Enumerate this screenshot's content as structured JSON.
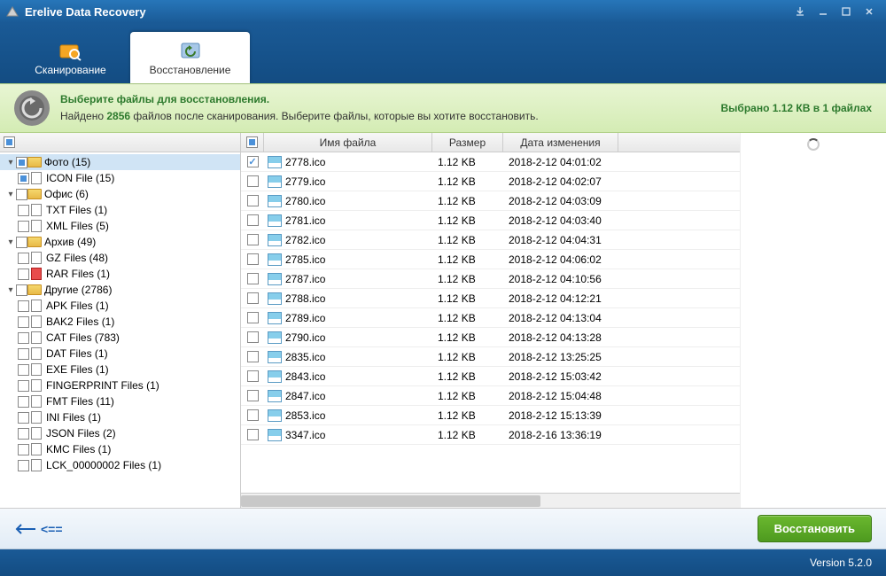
{
  "app": {
    "title": "Erelive Data Recovery"
  },
  "tabs": {
    "scan": "Сканирование",
    "recover": "Восстановление"
  },
  "info": {
    "title": "Выберите файлы для восстановления.",
    "found_prefix": "Найдено ",
    "found_count": "2856",
    "found_suffix": " файлов после сканирования. Выберите файлы, которые вы хотите восстановить.",
    "selected": "Выбрано 1.12 КВ в 1 файлах"
  },
  "tree": {
    "photo": {
      "label": "Фото (15)",
      "children": {
        "icon": "ICON File (15)"
      }
    },
    "office": {
      "label": "Офис (6)",
      "children": {
        "txt": "TXT Files (1)",
        "xml": "XML Files (5)"
      }
    },
    "archive": {
      "label": "Архив (49)",
      "children": {
        "gz": "GZ Files (48)",
        "rar": "RAR Files (1)"
      }
    },
    "other": {
      "label": "Другие (2786)",
      "children": {
        "apk": "APK Files (1)",
        "bak2": "BAK2 Files (1)",
        "cat": "CAT Files (783)",
        "dat": "DAT Files (1)",
        "exe": "EXE Files (1)",
        "fingerprint": "FINGERPRINT Files (1)",
        "fmt": "FMT Files (11)",
        "ini": "INI Files (1)",
        "json": "JSON Files (2)",
        "kmc": "KMC Files (1)",
        "lck": "LCK_00000002 Files (1)"
      }
    }
  },
  "columns": {
    "name": "Имя файла",
    "size": "Размер",
    "date": "Дата изменения"
  },
  "files": [
    {
      "name": "2778.ico",
      "size": "1.12 KB",
      "date": "2018-2-12 04:01:02",
      "checked": true
    },
    {
      "name": "2779.ico",
      "size": "1.12 KB",
      "date": "2018-2-12 04:02:07",
      "checked": false
    },
    {
      "name": "2780.ico",
      "size": "1.12 KB",
      "date": "2018-2-12 04:03:09",
      "checked": false
    },
    {
      "name": "2781.ico",
      "size": "1.12 KB",
      "date": "2018-2-12 04:03:40",
      "checked": false
    },
    {
      "name": "2782.ico",
      "size": "1.12 KB",
      "date": "2018-2-12 04:04:31",
      "checked": false
    },
    {
      "name": "2785.ico",
      "size": "1.12 KB",
      "date": "2018-2-12 04:06:02",
      "checked": false
    },
    {
      "name": "2787.ico",
      "size": "1.12 KB",
      "date": "2018-2-12 04:10:56",
      "checked": false
    },
    {
      "name": "2788.ico",
      "size": "1.12 KB",
      "date": "2018-2-12 04:12:21",
      "checked": false
    },
    {
      "name": "2789.ico",
      "size": "1.12 KB",
      "date": "2018-2-12 04:13:04",
      "checked": false
    },
    {
      "name": "2790.ico",
      "size": "1.12 KB",
      "date": "2018-2-12 04:13:28",
      "checked": false
    },
    {
      "name": "2835.ico",
      "size": "1.12 KB",
      "date": "2018-2-12 13:25:25",
      "checked": false
    },
    {
      "name": "2843.ico",
      "size": "1.12 KB",
      "date": "2018-2-12 15:03:42",
      "checked": false
    },
    {
      "name": "2847.ico",
      "size": "1.12 KB",
      "date": "2018-2-12 15:04:48",
      "checked": false
    },
    {
      "name": "2853.ico",
      "size": "1.12 KB",
      "date": "2018-2-12 15:13:39",
      "checked": false
    },
    {
      "name": "3347.ico",
      "size": "1.12 KB",
      "date": "2018-2-16 13:36:19",
      "checked": false
    }
  ],
  "buttons": {
    "back": "<==",
    "restore": "Восстановить"
  },
  "status": {
    "version": "Version 5.2.0"
  }
}
